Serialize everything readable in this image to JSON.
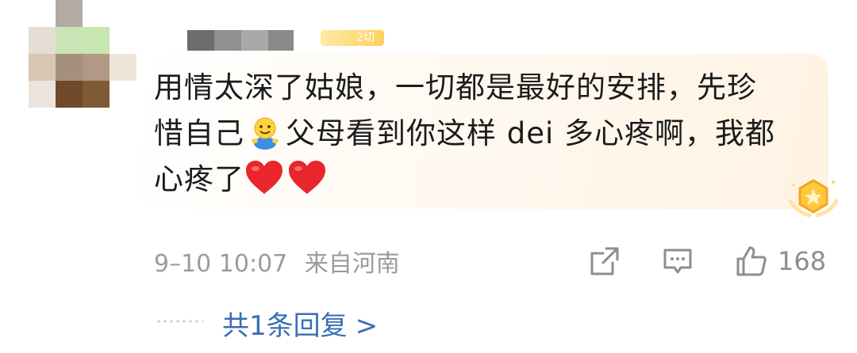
{
  "user": {
    "avatar": "pixelated-avatar",
    "name_blurred": true,
    "level_badge": "2切"
  },
  "comment": {
    "lines": [
      "用情太深了姑娘，一切都是最好的安排，先珍",
      "惜自己",
      "父母看到你这样 dei 多心疼啊，我都",
      "心疼了"
    ],
    "emojis": [
      "smiley-emoji",
      "red-heart-emoji",
      "red-heart-emoji"
    ]
  },
  "meta": {
    "timestamp": "9–10 10:07",
    "location": "来自河南"
  },
  "actions": {
    "share_icon": "share-icon",
    "comment_icon": "comment-icon",
    "like_icon": "thumbs-up-icon",
    "like_count": "168"
  },
  "replies": {
    "label": "共1条回复",
    "arrow": ">"
  },
  "colors": {
    "text": "#1b1b1b",
    "meta": "#9b9b9b",
    "link": "#3a6fb5",
    "heart": "#e8262b"
  }
}
